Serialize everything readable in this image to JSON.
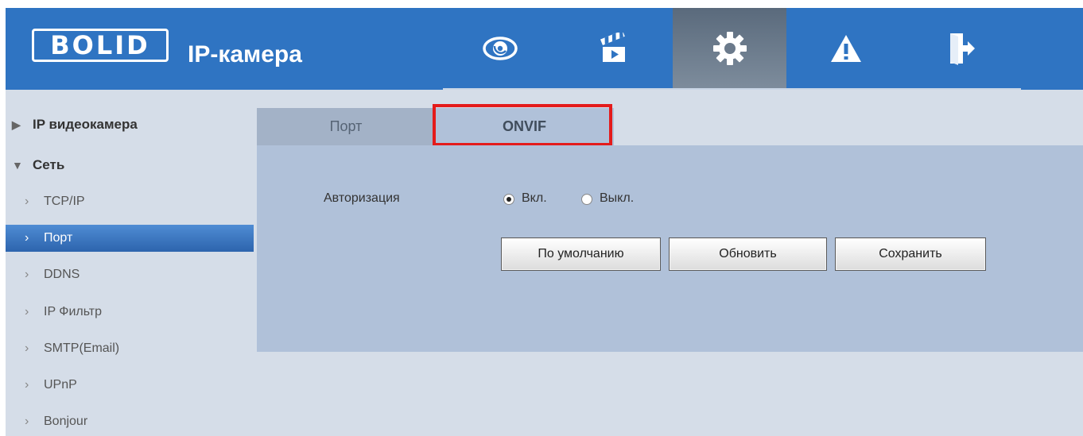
{
  "header": {
    "logo_text": "BOLID",
    "product_title": "IP-камера",
    "nav": [
      {
        "icon": "eye-icon"
      },
      {
        "icon": "clapperboard-icon"
      },
      {
        "icon": "gear-icon",
        "active": true
      },
      {
        "icon": "warning-icon"
      },
      {
        "icon": "logout-icon"
      }
    ]
  },
  "sidebar": {
    "groups": [
      {
        "label": "IP видеокамера",
        "expanded": false
      },
      {
        "label": "Сеть",
        "expanded": true
      }
    ],
    "items": [
      {
        "label": "TCP/IP"
      },
      {
        "label": "Порт",
        "selected": true
      },
      {
        "label": "DDNS"
      },
      {
        "label": "IP Фильтр"
      },
      {
        "label": "SMTP(Email)"
      },
      {
        "label": "UPnP"
      },
      {
        "label": "Bonjour"
      }
    ]
  },
  "tabs": [
    {
      "label": "Порт"
    },
    {
      "label": "ONVIF",
      "active": true
    }
  ],
  "form": {
    "auth_label": "Авторизация",
    "radio_on_label": "Вкл.",
    "radio_off_label": "Выкл.",
    "selected": "on"
  },
  "buttons": {
    "default_label": "По умолчанию",
    "refresh_label": "Обновить",
    "save_label": "Сохранить"
  },
  "colors": {
    "header_bg": "#2f74c2",
    "highlight": "#e41b1b",
    "selected_item": "#3a75c0"
  }
}
